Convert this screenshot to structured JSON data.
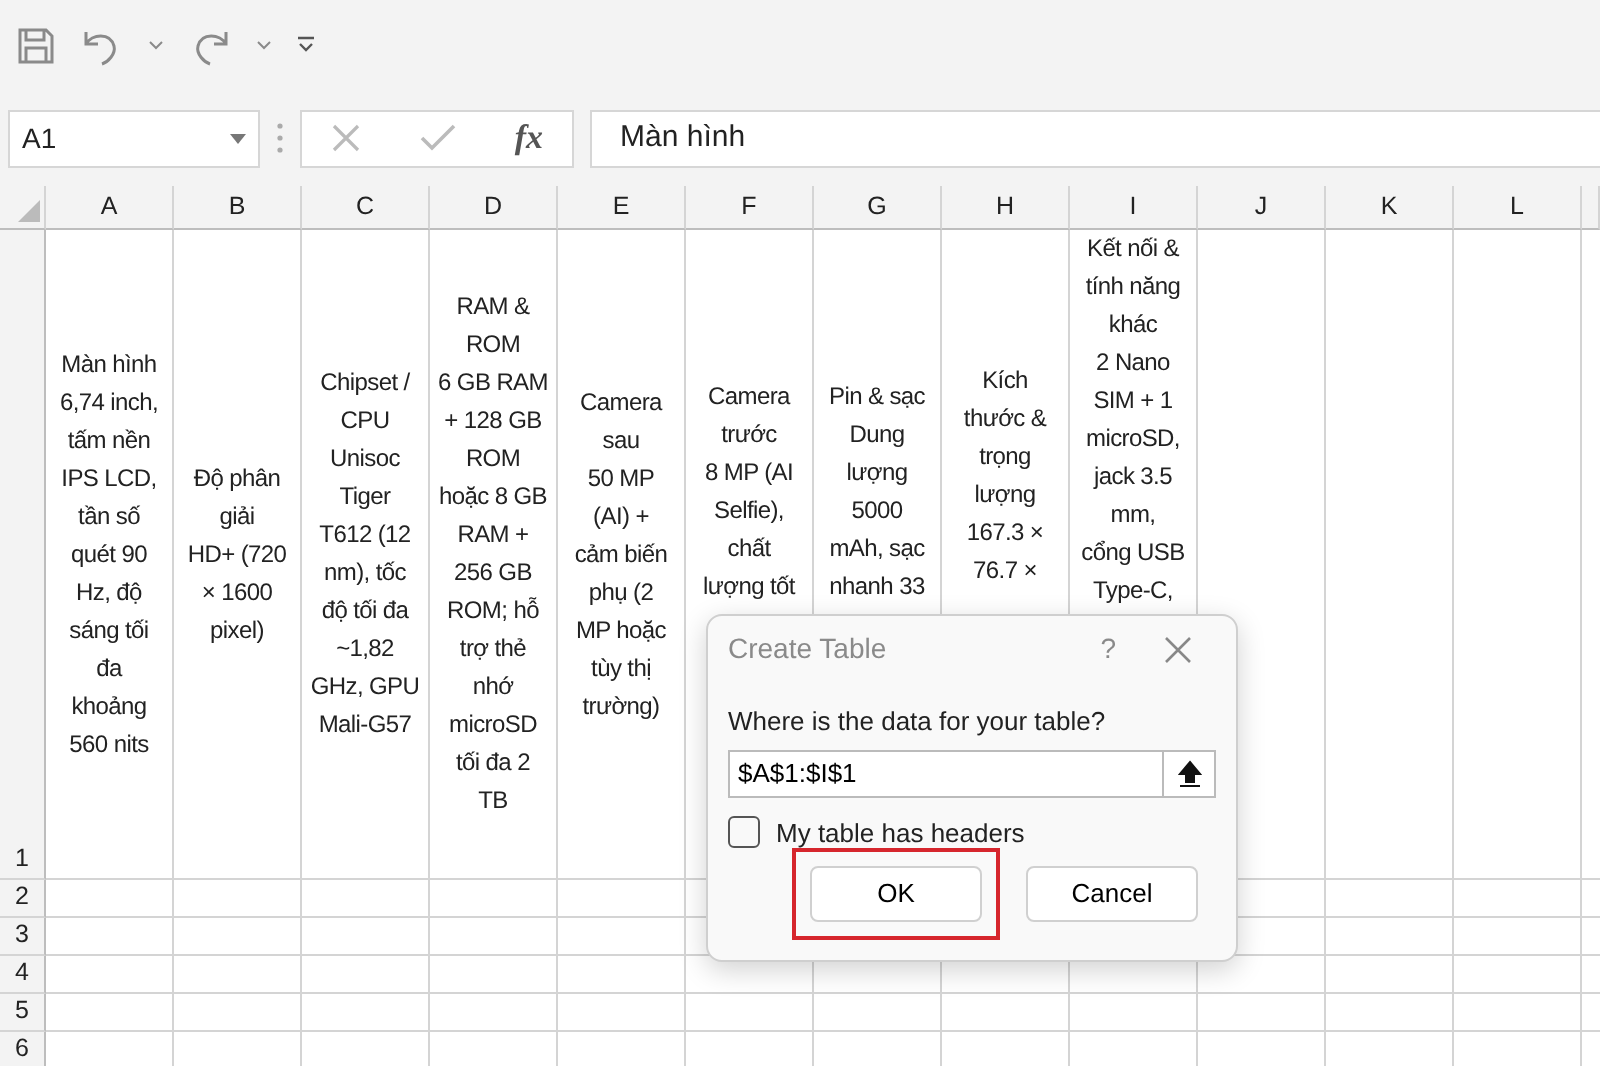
{
  "name_box": {
    "value": "A1"
  },
  "formula_bar": {
    "function_label": "fx",
    "value": "Màn hình"
  },
  "sheet": {
    "columns": [
      "A",
      "B",
      "C",
      "D",
      "E",
      "F",
      "G",
      "H",
      "I",
      "J",
      "K",
      "L"
    ],
    "rows": [
      "1",
      "2",
      "3",
      "4",
      "5",
      "6"
    ],
    "row_1_cells": [
      "Màn hình\n6,74 inch,\ntấm nền\nIPS LCD,\ntần số\nquét 90\nHz, độ\nsáng tối\nđa\nkhoảng\n560 nits",
      "Độ phân\ngiải\nHD+ (720\n× 1600\npixel)",
      "Chipset /\nCPU\nUnisoc\nTiger\nT612 (12\nnm), tốc\nđộ tối đa\n~1,82\nGHz, GPU\nMali-G57",
      "RAM &\nROM\n6 GB RAM\n+ 128 GB\nROM\nhoặc 8 GB\nRAM +\n256 GB\nROM; hỗ\ntrợ thẻ\nnhớ\nmicroSD\ntối đa 2\nTB",
      "Camera\nsau\n50 MP\n(AI) +\ncảm biến\nphụ (2\nMP hoặc\ntùy thị\ntrường)",
      "Camera\ntrước\n8 MP (AI\nSelfie),\nchất\nlượng tốt",
      "Pin & sạc\nDung\nlượng\n5000\nmAh, sạc\nnhanh 33",
      "Kích\nthước &\ntrọng\nlượng\n167.3 ×\n76.7 ×",
      "Kết nối &\ntính năng\nkhác\n2 Nano\nSIM + 1\nmicroSD,\njack 3.5\nmm,\ncổng USB\nType-C,"
    ]
  },
  "dialog": {
    "title": "Create Table",
    "help": "?",
    "prompt": "Where is the data for your table?",
    "range": "$A$1:$I$1",
    "checkbox": {
      "label": "My table has headers",
      "checked": false
    },
    "buttons": [
      {
        "label": "OK",
        "highlighted": true
      },
      {
        "label": "Cancel",
        "highlighted": false
      }
    ]
  }
}
